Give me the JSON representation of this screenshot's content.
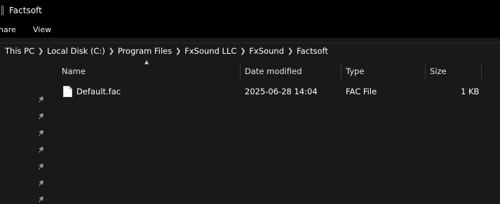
{
  "window": {
    "title": "Factsoft"
  },
  "menu": {
    "share": "hare",
    "view": "View"
  },
  "breadcrumb": [
    "This PC",
    "Local Disk (C:)",
    "Program Files",
    "FxSound LLC",
    "FxSound",
    "Factsoft"
  ],
  "columns": {
    "name": "Name",
    "date": "Date modified",
    "type": "Type",
    "size": "Size"
  },
  "files": [
    {
      "name": "Default.fac",
      "date": "2025-06-28 14:04",
      "type": "FAC File",
      "size": "1 KB"
    }
  ],
  "icons": {
    "pin": "pin-icon",
    "file": "file-icon",
    "chevron": "chevron-right-icon",
    "sort": "sort-up-icon"
  }
}
